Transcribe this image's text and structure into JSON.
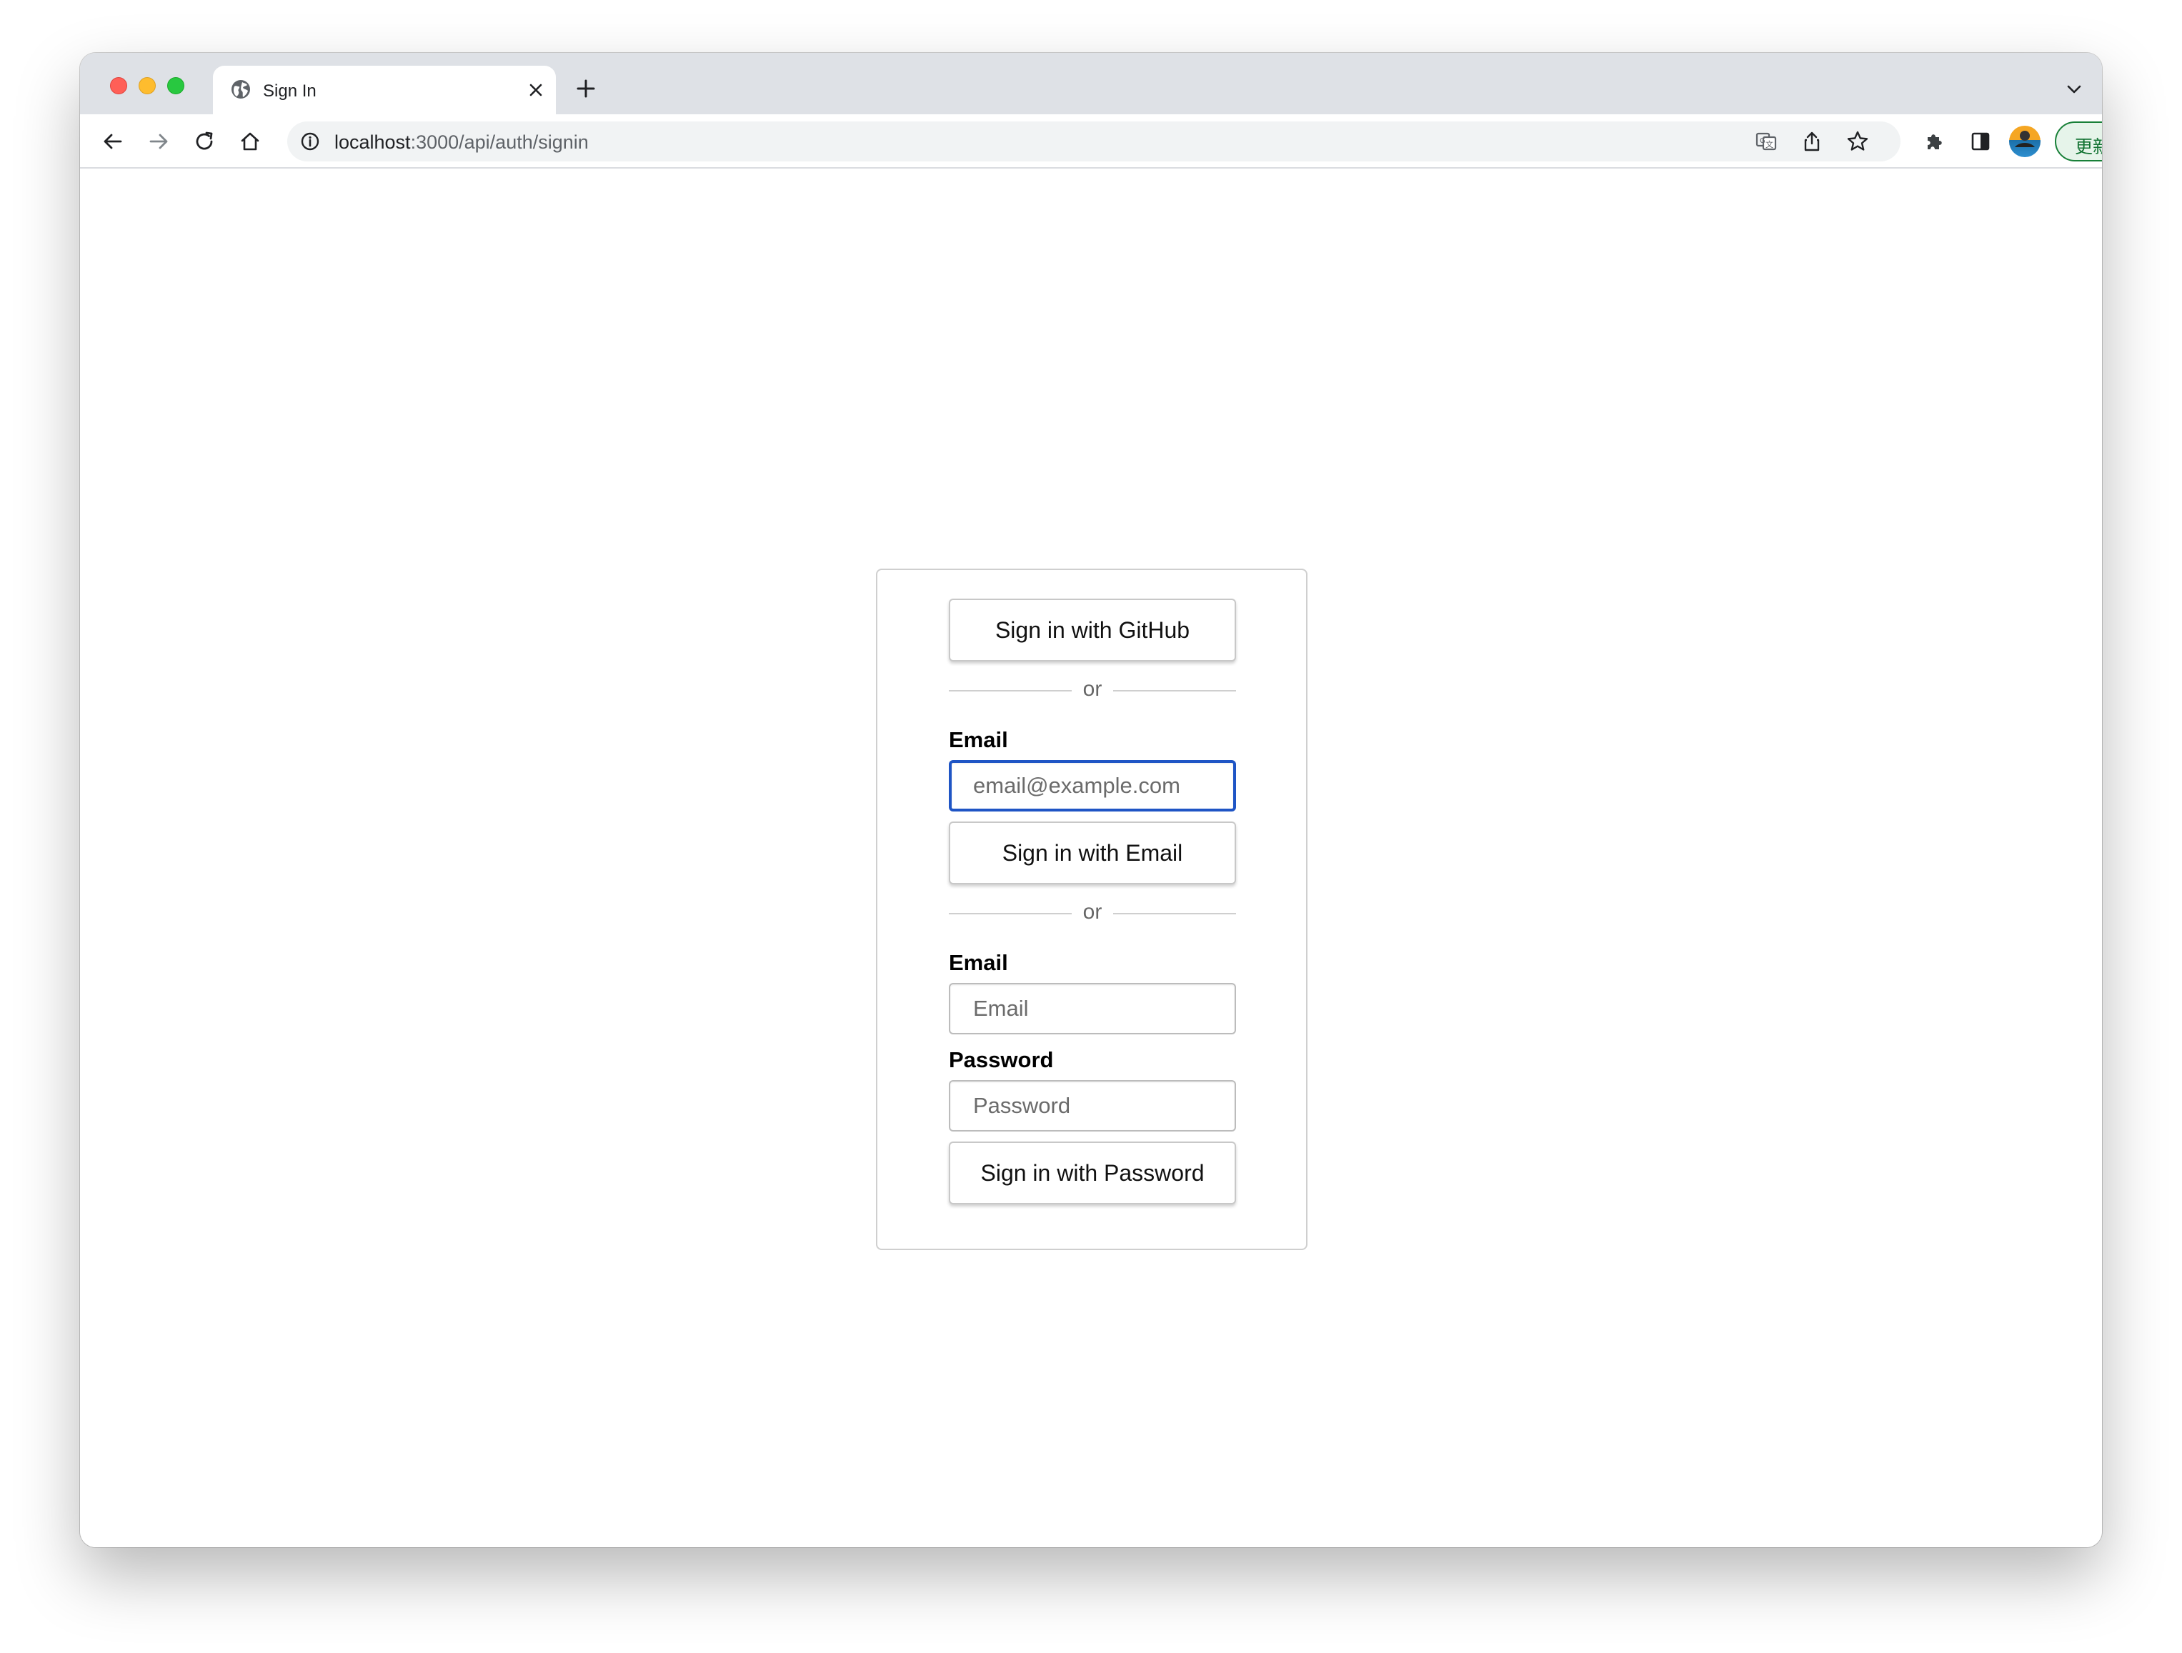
{
  "browser": {
    "tab_title": "Sign In",
    "url_host": "localhost",
    "url_path": ":3000/api/auth/signin",
    "update_label": "更新",
    "icons": [
      "globe-icon",
      "close-icon",
      "plus-icon",
      "chevron-down-icon",
      "back-icon",
      "forward-icon",
      "reload-icon",
      "home-icon",
      "info-icon",
      "translate-icon",
      "share-icon",
      "star-icon",
      "puzzle-icon",
      "sidepanel-icon",
      "avatar",
      "more-vert-icon"
    ]
  },
  "signin": {
    "github_button": "Sign in with GitHub",
    "divider_1": "or",
    "email_label": "Email",
    "email_placeholder": "email@example.com",
    "email_button": "Sign in with Email",
    "divider_2": "or",
    "cred_email_label": "Email",
    "cred_email_placeholder": "Email",
    "password_label": "Password",
    "password_placeholder": "Password",
    "password_button": "Sign in with Password"
  },
  "colors": {
    "focus_border": "#1f55c5",
    "update_green": "#137333",
    "tabbar_bg": "#dee1e6"
  }
}
